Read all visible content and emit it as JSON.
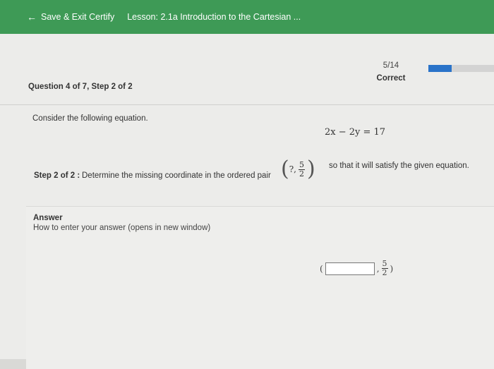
{
  "header": {
    "back_label": "Save & Exit Certify",
    "lesson_title": "Lesson: 2.1a Introduction to the Cartesian ..."
  },
  "question": {
    "label": "Question 4 of 7, Step 2 of 2",
    "score": "5/14",
    "status": "Correct",
    "progress_fraction": 0.357
  },
  "problem": {
    "prompt": "Consider the following equation.",
    "equation": "2x − 2y = 17",
    "step_label": "Step 2 of 2 :",
    "instruction": "Determine the missing coordinate in the ordered pair",
    "pair_unknown": "?",
    "pair_comma": ",",
    "pair_num": "5",
    "pair_den": "2",
    "instruction_tail": "so that it will satisfy the given equation."
  },
  "answer": {
    "title": "Answer",
    "howto": "How to enter your answer (opens in new window)",
    "input_value": "",
    "open": "(",
    "comma": ",",
    "num": "5",
    "den": "2",
    "close": ")"
  },
  "colors": {
    "header_green": "#3e9a56",
    "progress_blue": "#2a73c9"
  }
}
